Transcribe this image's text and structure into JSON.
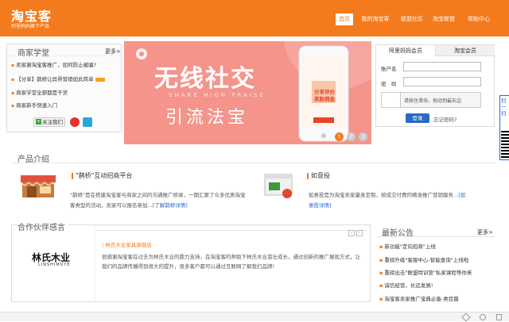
{
  "header": {
    "logo": "淘宝客",
    "subtitle": "阿里妈妈旗下产品",
    "nav": [
      "首页",
      "我的淘宝客",
      "联盟社区",
      "淘宝联盟",
      "帮助中心"
    ]
  },
  "school": {
    "title": "商家学堂",
    "more": "更多>",
    "items": [
      "卖家谢淘宝客推广，如何防止被骗?",
      "【分享】鹊桥让异界营销如此简单",
      "商家学堂全部都是干货",
      "商家新手快速入门"
    ],
    "follow": "关注我们"
  },
  "banner": {
    "headline": "无线社交",
    "english": "SHARE HIGH PRAISE",
    "tagline": "引流法宝",
    "phone_line1": "分享评价",
    "phone_line2": "奖励佣金",
    "dots": [
      "1",
      "2",
      "3"
    ]
  },
  "login": {
    "tab1": "阿里妈妈会员",
    "tab2": "淘宝会员",
    "account_label": "账户名",
    "password_label": "密　码",
    "slider_text": "请按住滑块，拖动到最右边",
    "login_btn": "登录",
    "forgot": "忘记密码?"
  },
  "side": {
    "label": "扫一扫"
  },
  "products": {
    "title": "产品介绍",
    "p1_title": "\"鹊桥\"互动招商平台",
    "p1_desc": "\"鹊桥\"是在搭建淘宝客与商家之间的沟通推广桥梁，一期汇聚了众多优质淘宝客类型的活动，卖家可以报名参加...",
    "p1_link": "[了解鹊桥详情]",
    "p2_title": "如意投",
    "p2_desc": "如意投是为淘宝卖家量身定制，按成交付费的精准推广营销服务...",
    "p2_more": "[如",
    "p2_link": "意投详情]"
  },
  "partner": {
    "title": "合作伙伴感言",
    "company": "林氏木业家具旗舰店",
    "logo_cn": "林氏木业",
    "logo_en": "LINSHIMUYE",
    "quote": "很感谢淘宝客在过去为林氏木业的鼎力支持，在淘宝客的帮助下林氏木业茁壮成长，通过创新的推广展现方式，让我们的品牌传播得到很大的提升，很多客户都可以通过互联网了解我们品牌!"
  },
  "news": {
    "title": "最新公告",
    "more": "更多>",
    "items": [
      "新功能\"定向招商\"上线",
      "重磅升级\"客服中心-智能查询\"上线啦",
      "重磅出击\"联盟特训营\"私家课程等你来",
      "诚信经营，长远发展!",
      "淘宝客卖家推广宝典必备-类目篇"
    ]
  },
  "colors": {
    "brand": "#f37b1d",
    "link": "#2b67c6"
  }
}
